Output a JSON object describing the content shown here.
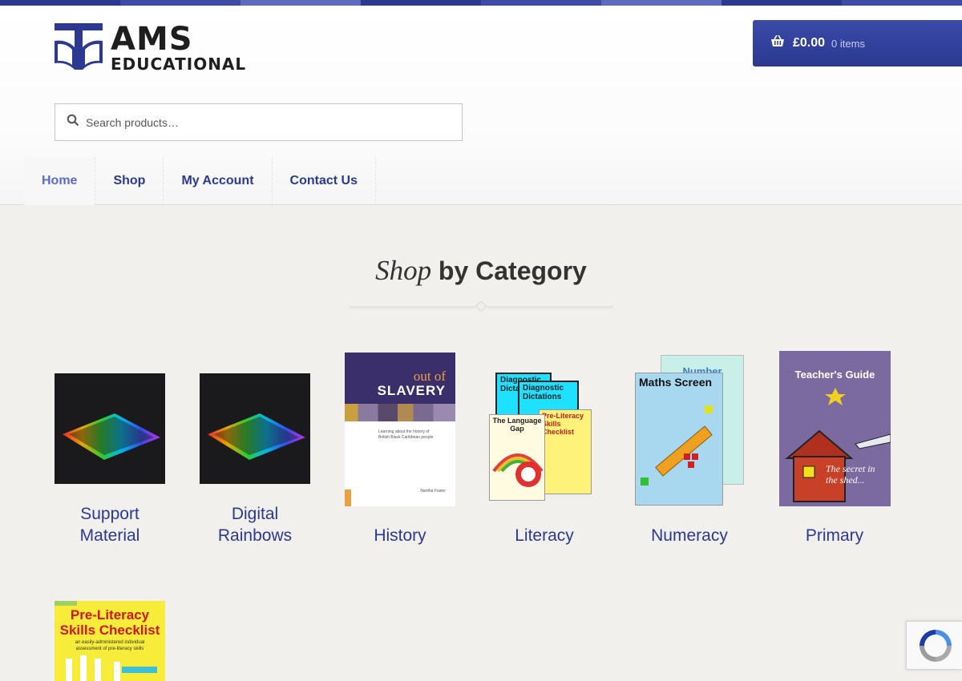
{
  "colors": {
    "brand": "#2b3990",
    "brand_light": "#5a6bc8",
    "page_bg": "#f2f0ed",
    "topbar": [
      "#2b3990",
      "#3d4da6",
      "#5d6bbf",
      "#2b3990",
      "#3d4da6",
      "#5d6bbf",
      "#2b3990",
      "#3d4da6"
    ]
  },
  "logo": {
    "line1": "AMS",
    "line2": "EDUCATIONAL"
  },
  "cart": {
    "amount": "£0.00",
    "items": "0 items",
    "icon": "basket-icon"
  },
  "search": {
    "placeholder": "Search products…",
    "icon": "search-icon"
  },
  "nav": {
    "items": [
      {
        "label": "Home",
        "active": true
      },
      {
        "label": "Shop"
      },
      {
        "label": "My Account"
      },
      {
        "label": "Contact Us"
      }
    ]
  },
  "section": {
    "title_italic": "Shop",
    "title_bold": "by Category"
  },
  "categories": [
    {
      "label_line1": "Support",
      "label_line2": "Material"
    },
    {
      "label_line1": "Digital",
      "label_line2": "Rainbows"
    },
    {
      "label_line1": "",
      "label_line2": "History",
      "cover_title1": "out of",
      "cover_title2": "SLAVERY",
      "cover_text": "Learning about the history of British Black Caribbean people",
      "cover_author": "Nantha Foster"
    },
    {
      "label_line1": "",
      "label_line2": "Literacy",
      "cover_titles": [
        "Diagnostic Dictations",
        "Diagnostic Dictations",
        "Pre-Literacy Skills Checklist",
        "The Language Gap"
      ]
    },
    {
      "label_line1": "",
      "label_line2": "Numeracy",
      "cover_title": "Maths Screen",
      "cover_title_back": "Number"
    },
    {
      "label_line1": "",
      "label_line2": "Primary",
      "cover_title": "Teacher's Guide",
      "cover_sub": "The secret in the shed..."
    }
  ],
  "extra_category": {
    "cover_title1": "Pre-Literacy",
    "cover_title2": "Skills Checklist",
    "cover_sub": "an easily-administered individual assessment of pre-literacy skills"
  }
}
